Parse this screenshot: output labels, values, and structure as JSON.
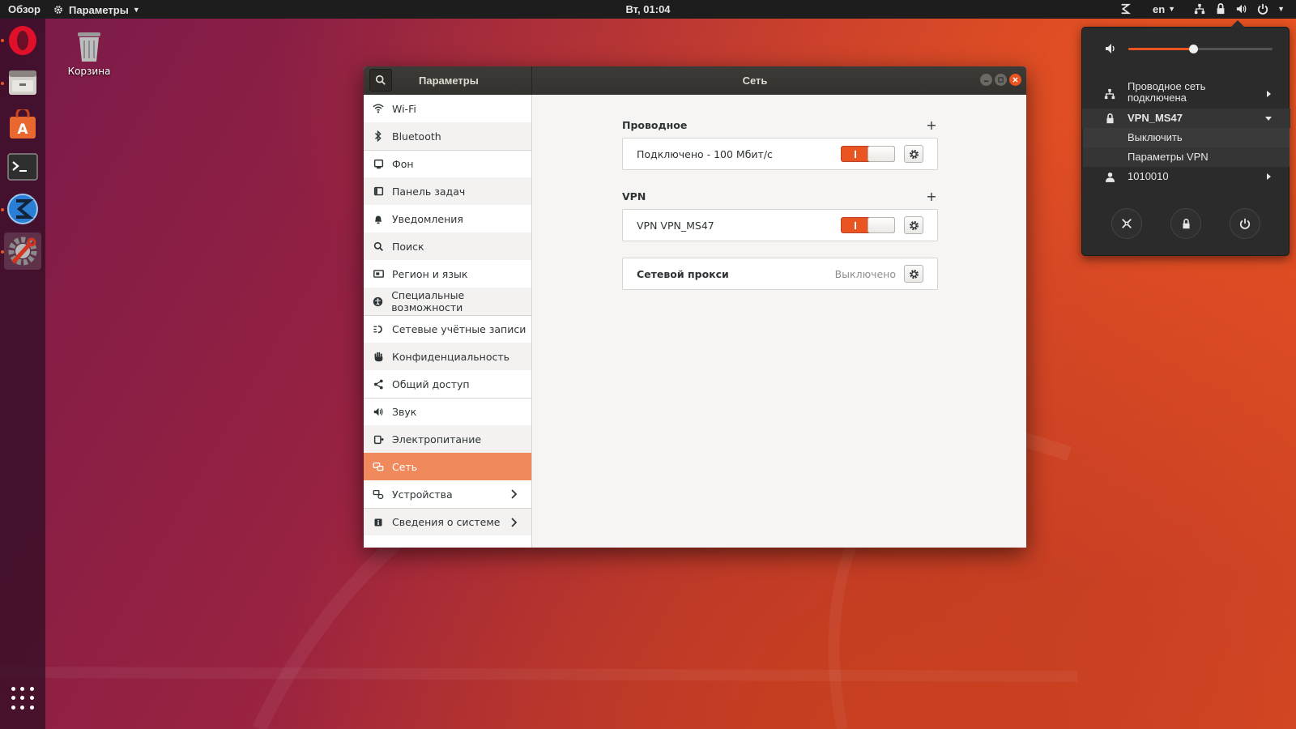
{
  "topbar": {
    "activities": "Обзор",
    "app_menu": "Параметры",
    "clock": "Вт, 01:04",
    "keyboard_layout": "en"
  },
  "desktop": {
    "trash_label": "Корзина"
  },
  "window": {
    "sidebar_title": "Параметры",
    "main_title": "Сеть"
  },
  "sidebar": {
    "items": [
      {
        "label": "Wi-Fi",
        "icon": "wifi-icon"
      },
      {
        "label": "Bluetooth",
        "icon": "bluetooth-icon"
      },
      {
        "label": "Фон",
        "icon": "background-icon"
      },
      {
        "label": "Панель задач",
        "icon": "dock-icon"
      },
      {
        "label": "Уведомления",
        "icon": "bell-icon"
      },
      {
        "label": "Поиск",
        "icon": "search-icon"
      },
      {
        "label": "Регион и язык",
        "icon": "flag-icon"
      },
      {
        "label": "Специальные возможности",
        "icon": "accessibility-icon"
      },
      {
        "label": "Сетевые учётные записи",
        "icon": "online-accounts-icon"
      },
      {
        "label": "Конфиденциальность",
        "icon": "hand-icon"
      },
      {
        "label": "Общий доступ",
        "icon": "share-icon"
      },
      {
        "label": "Звук",
        "icon": "speaker-icon"
      },
      {
        "label": "Электропитание",
        "icon": "power-icon"
      },
      {
        "label": "Сеть",
        "icon": "network-icon"
      },
      {
        "label": "Устройства",
        "icon": "devices-icon"
      },
      {
        "label": "Сведения о системе",
        "icon": "info-icon"
      }
    ],
    "selected": "Сеть"
  },
  "network": {
    "wired": {
      "heading": "Проводное",
      "status": "Подключено - 100 Мбит/с",
      "enabled": true
    },
    "vpn": {
      "heading": "VPN",
      "name": "VPN VPN_MS47",
      "enabled": true
    },
    "proxy": {
      "label": "Сетевой прокси",
      "status": "Выключено"
    }
  },
  "system_menu": {
    "volume_level": 0.45,
    "wired_label": "Проводное сеть подключена",
    "vpn_label": "VPN_MS47",
    "vpn_disable": "Выключить",
    "vpn_settings": "Параметры VPN",
    "user_label": "1010010"
  },
  "colors": {
    "accent": "#e95420",
    "selected_row": "#f08a5d",
    "panel": "#1d1d1d"
  }
}
